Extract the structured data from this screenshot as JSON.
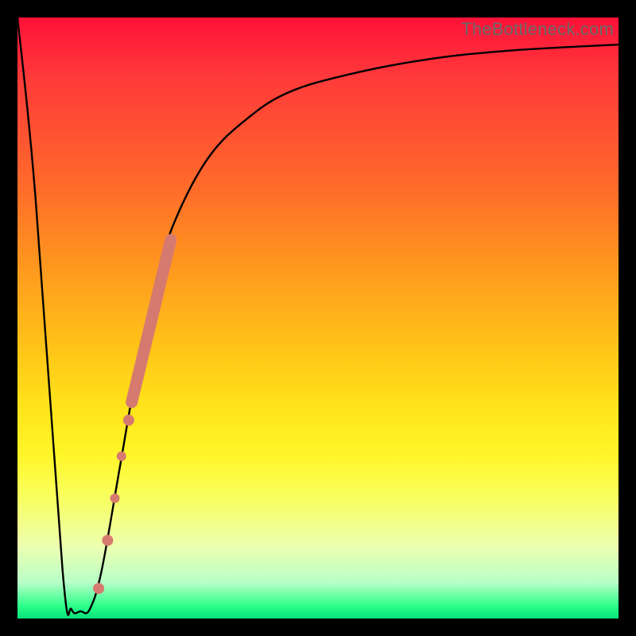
{
  "watermark": "TheBottleneck.com",
  "chart_data": {
    "type": "line",
    "title": "",
    "xlabel": "",
    "ylabel": "",
    "xlim": [
      0,
      100
    ],
    "ylim": [
      0,
      100
    ],
    "grid": false,
    "legend": false,
    "series": [
      {
        "name": "bottleneck-curve",
        "color": "#000000",
        "x": [
          0.0,
          3.0,
          7.5,
          9.0,
          10.5,
          12.0,
          14.0,
          17.0,
          20.0,
          23.5,
          27.0,
          32.0,
          38.0,
          45.0,
          55.0,
          68.0,
          82.0,
          100.0
        ],
        "y": [
          100,
          70,
          8.0,
          1.5,
          1.2,
          1.5,
          8.0,
          25.0,
          42.0,
          58.0,
          68.0,
          77.0,
          83.0,
          87.5,
          90.5,
          93.0,
          94.5,
          95.5
        ]
      },
      {
        "name": "highlighted-points",
        "color": "#d67a6f",
        "type": "scatter",
        "points": [
          {
            "x": 13.5,
            "y": 5,
            "r": 7
          },
          {
            "x": 15.0,
            "y": 13,
            "r": 7
          },
          {
            "x": 16.2,
            "y": 20,
            "r": 6
          },
          {
            "x": 17.3,
            "y": 27,
            "r": 6
          },
          {
            "x": 18.5,
            "y": 33,
            "r": 7
          }
        ]
      },
      {
        "name": "highlighted-band",
        "color": "#d67a6f",
        "type": "line-thick",
        "x": [
          19.0,
          25.5
        ],
        "y": [
          36.0,
          63.0
        ]
      }
    ],
    "background_gradient": {
      "top": "#ff1038",
      "bottom": "#06e27a"
    }
  }
}
